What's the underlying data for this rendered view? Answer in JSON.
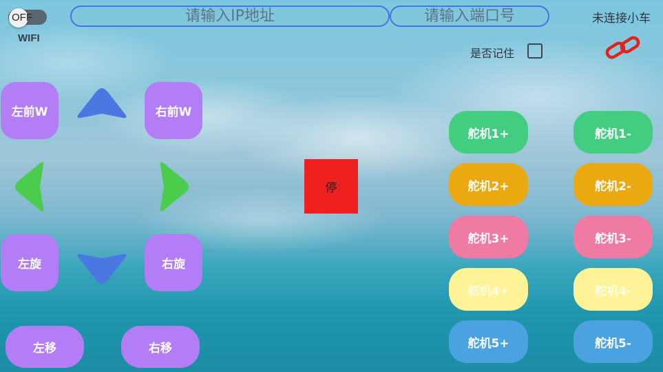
{
  "header": {
    "wifi_toggle_state": "OFF",
    "wifi_label": "WIFI",
    "ip_placeholder": "请输入IP地址",
    "port_placeholder": "请输入端口号",
    "connection_status": "未连接小车",
    "remember_label": "是否记住"
  },
  "drive": {
    "left_forward": "左前W",
    "right_forward": "右前W",
    "rotate_left": "左旋",
    "rotate_right": "右旋",
    "move_left": "左移",
    "move_right": "右移",
    "stop": "停"
  },
  "servos": {
    "s1_plus": "舵机1+",
    "s1_minus": "舵机1-",
    "s2_plus": "舵机2+",
    "s2_minus": "舵机2-",
    "s3_plus": "舵机3+",
    "s3_minus": "舵机3-",
    "s4_plus": "舵机4+",
    "s4_minus": "舵机4-",
    "s5_plus": "舵机5+",
    "s5_minus": "舵机5-"
  },
  "colors": {
    "pad_button": "#b27df5",
    "arrow_vertical": "#4a78e0",
    "arrow_horizontal": "#4ccc4c",
    "stop": "#ee2020",
    "servo1": "#43cd81",
    "servo2": "#eaa911",
    "servo3": "#ef7aa4",
    "servo4": "#fef396",
    "servo5": "#4aa2e0",
    "link_icon": "#e0231b"
  },
  "icons": {
    "link": "link-icon",
    "up": "arrow-up-icon",
    "down": "arrow-down-icon",
    "left": "arrow-left-icon",
    "right": "arrow-right-icon"
  }
}
